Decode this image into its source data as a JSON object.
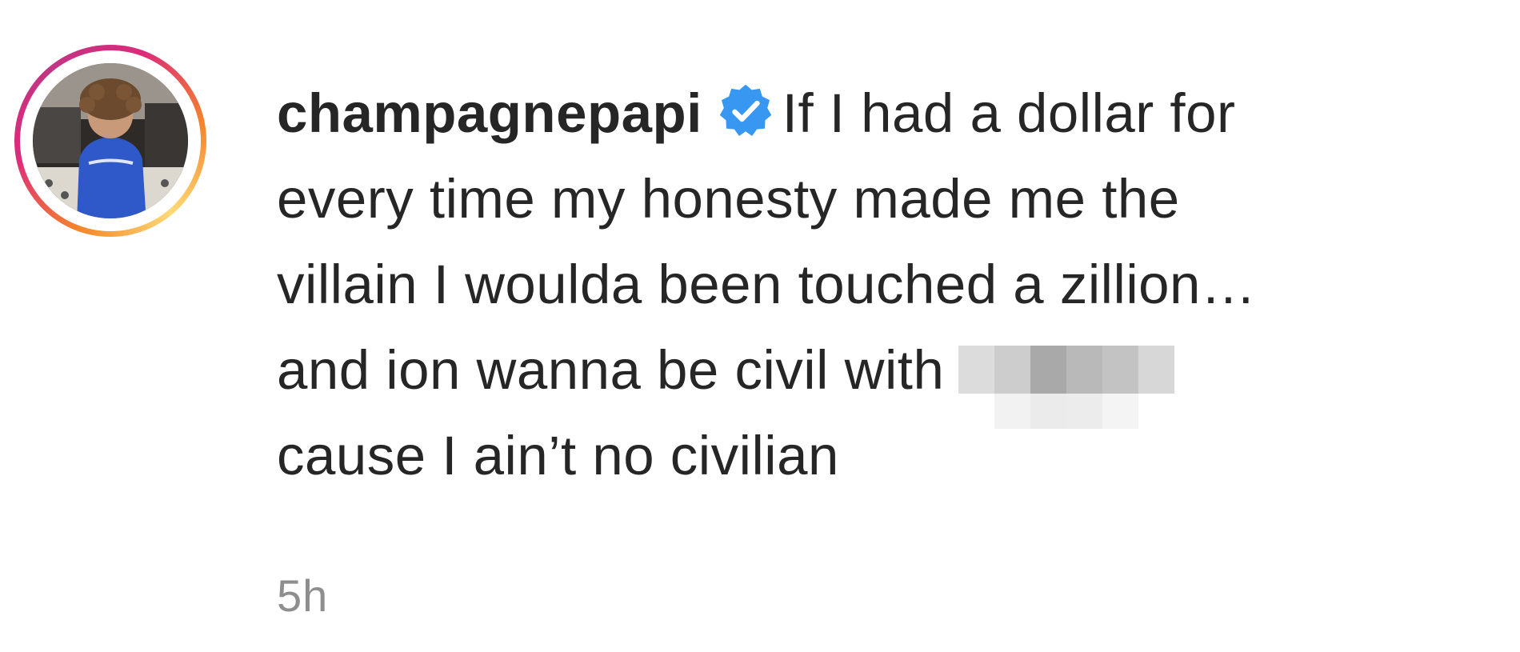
{
  "post": {
    "username": "champagnepapi",
    "verified_icon": "verified-badge-icon",
    "caption_lines": [
      "If I had a dollar for",
      "every time my honesty made me the",
      "villain I woulda been touched a zillion…",
      "and ion wanna be civil with",
      "cause I ain’t no civilian"
    ],
    "timestamp": "5h"
  },
  "colors": {
    "text": "#262626",
    "muted": "#8e8e8e",
    "verified": "#3897f0",
    "ring_start": "#f58529",
    "ring_end": "#dd2a7b"
  }
}
